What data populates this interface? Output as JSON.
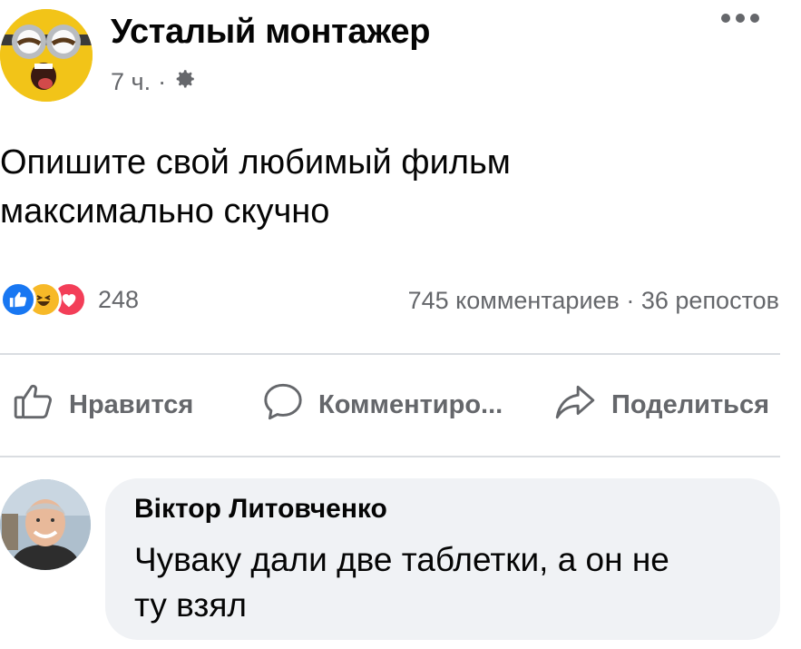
{
  "post": {
    "author": "Усталый монтажер",
    "time": "7 ч.",
    "separator": "·",
    "privacy_icon": "gear-icon",
    "text_lines": [
      "Опишите свой любимый фильм",
      "максимально скучно"
    ]
  },
  "reactions": {
    "icons": [
      "like-icon",
      "haha-icon",
      "love-icon"
    ],
    "count": "248"
  },
  "stats": "745 комментариев · 36 репостов",
  "actions": {
    "like": "Нравится",
    "comment": "Комментиро...",
    "share": "Поделиться"
  },
  "comment": {
    "author": "Віктор Литовченко",
    "text_lines": [
      "Чуваку дали две таблетки, а он не",
      "ту взял"
    ]
  },
  "colors": {
    "like_blue": "#1877f2",
    "love_red": "#f33e58",
    "haha_yellow": "#f7b928",
    "secondary_text": "#65676b",
    "bubble_bg": "#f0f2f5"
  }
}
